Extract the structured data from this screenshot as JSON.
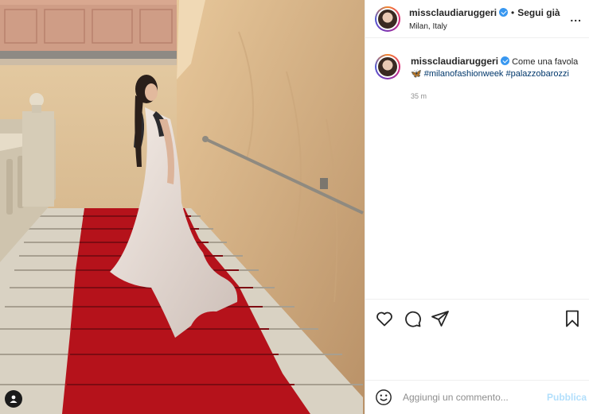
{
  "post": {
    "username": "missclaudiaruggeri",
    "follow_status": "Segui già",
    "location": "Milan, Italy",
    "more_label": "...",
    "caption_text": "Come una favola",
    "caption_emoji": "🦋",
    "hashtags": [
      "#milanofashionweek",
      "#palazzobarozzi"
    ],
    "time_ago": "35 m"
  },
  "comment_box": {
    "placeholder": "Aggiungi un commento...",
    "publish_label": "Pubblica"
  },
  "icons": {
    "like": "heart-icon",
    "comment": "comment-icon",
    "share": "paper-plane-icon",
    "save": "bookmark-icon",
    "emoji": "smiley-icon",
    "tags": "user-tag-icon"
  },
  "colors": {
    "link": "#00376b",
    "verified": "#3897f0",
    "publish_disabled": "#b2dffc",
    "carpet": "#b5121b"
  }
}
